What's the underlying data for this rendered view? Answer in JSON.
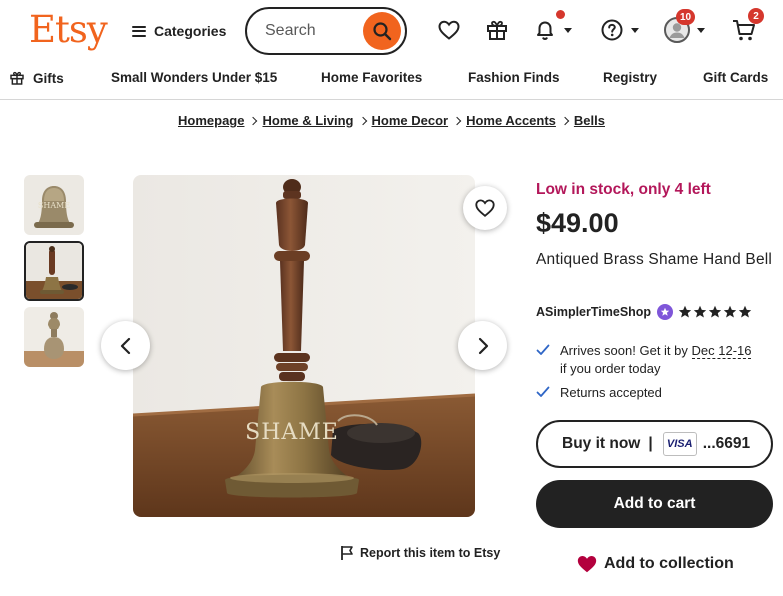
{
  "header": {
    "logo": "Etsy",
    "categories_label": "Categories",
    "search_placeholder": "Search",
    "account_badge": "10",
    "cart_badge": "2"
  },
  "nav": {
    "items": [
      {
        "label": "Gifts",
        "icon": "gift-icon"
      },
      {
        "label": "Small Wonders Under $15"
      },
      {
        "label": "Home Favorites"
      },
      {
        "label": "Fashion Finds"
      },
      {
        "label": "Registry"
      },
      {
        "label": "Gift Cards"
      }
    ]
  },
  "breadcrumb": [
    "Homepage",
    "Home & Living",
    "Home Decor",
    "Home Accents",
    "Bells"
  ],
  "gallery": {
    "thumbnail_count": 3,
    "selected_index": 1,
    "main_image_text": "SHAME"
  },
  "report_label": "Report this item to Etsy",
  "product": {
    "stock_status": "Low in stock, only 4 left",
    "price": "$49.00",
    "title": "Antiqued Brass Shame Hand Bell",
    "shop_name": "ASimplerTimeShop",
    "rating": 5,
    "shipping_prefix": "Arrives soon! Get it by ",
    "shipping_dates": "Dec 12-16",
    "shipping_suffix": "if you order today",
    "returns": "Returns accepted",
    "buy_now_label": "Buy it now",
    "card_brand": "VISA",
    "card_last4": "...6691",
    "add_to_cart_label": "Add to cart",
    "add_to_collection_label": "Add to collection"
  },
  "colors": {
    "brand": "#f1641e",
    "stock": "#b3175a",
    "badge": "#d5372d",
    "check": "#2f66c6",
    "favorite_heart": "#b3003d",
    "star_seller": "#7f56d9"
  }
}
